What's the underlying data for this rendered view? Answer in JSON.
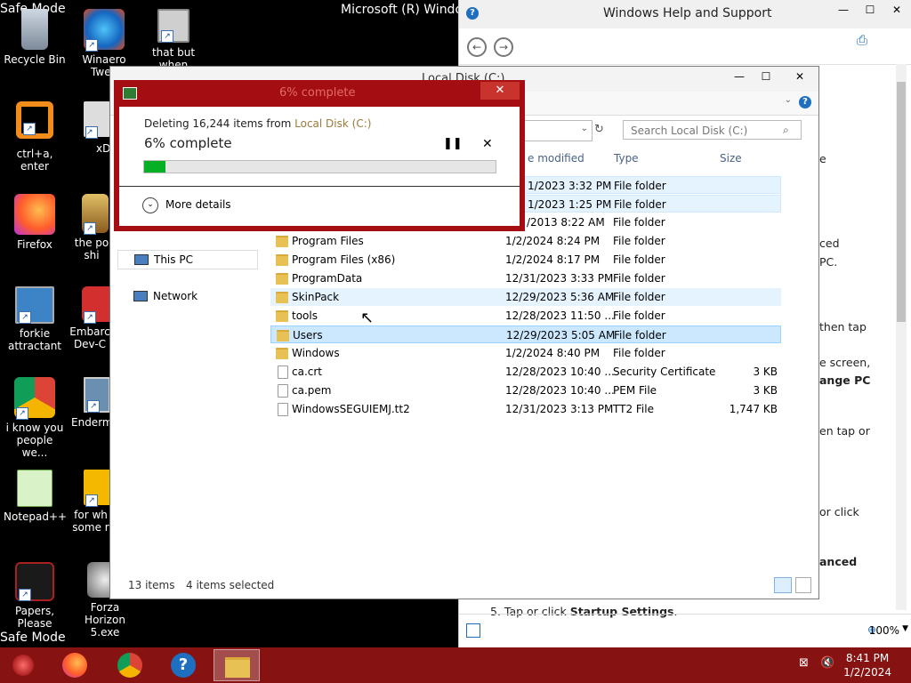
{
  "desktop": {
    "safe_mode_top": "Safe Mode",
    "safe_mode_bottom": "Safe Mode",
    "background_title": "Microsoft (R) Windo",
    "icons": [
      {
        "label": "Recycle Bin"
      },
      {
        "label": "Winaero Twea"
      },
      {
        "label": "that but when"
      },
      {
        "label": "ctrl+a, enter"
      },
      {
        "label": "xD"
      },
      {
        "label": "Firefox"
      },
      {
        "label": "the po shi"
      },
      {
        "label": "forkie attractant"
      },
      {
        "label": "Embarc Dev-C"
      },
      {
        "label": "i know you people we..."
      },
      {
        "label": "Enderm"
      },
      {
        "label": "Notepad++"
      },
      {
        "label": "for wh some r"
      },
      {
        "label": "Papers, Please"
      },
      {
        "label": "Forza Horizon 5.exe"
      }
    ]
  },
  "help": {
    "title": "Windows Help and Support",
    "fragments": [
      "ced",
      "PC.",
      "then tap",
      "e screen,",
      "ange PC",
      "en tap or",
      "or click",
      "anced",
      "e"
    ],
    "step": "5.  Tap or click ",
    "step_bold": "Startup Settings",
    "step_end": ".",
    "zoom": "100%"
  },
  "explorer": {
    "title": "Local Disk (C:)",
    "search_placeholder": "Search Local Disk (C:)",
    "columns": {
      "modified": "e modified",
      "type": "Type",
      "size": "Size"
    },
    "nav": {
      "this_pc": "This PC",
      "network": "Network"
    },
    "partial_rows": [
      {
        "date": "1/2023 3:32 PM",
        "type": "File folder"
      },
      {
        "date": "1/2023 1:25 PM",
        "type": "File folder"
      },
      {
        "date": "/2013 8:22 AM",
        "type": "File folder"
      }
    ],
    "rows": [
      {
        "name": "Program Files",
        "date": "1/2/2024 8:24 PM",
        "type": "File folder",
        "size": "",
        "kind": "folder"
      },
      {
        "name": "Program Files (x86)",
        "date": "1/2/2024 8:17 PM",
        "type": "File folder",
        "size": "",
        "kind": "folder"
      },
      {
        "name": "ProgramData",
        "date": "12/31/2023 3:33 PM",
        "type": "File folder",
        "size": "",
        "kind": "folder"
      },
      {
        "name": "SkinPack",
        "date": "12/29/2023 5:36 AM",
        "type": "File folder",
        "size": "",
        "kind": "folder"
      },
      {
        "name": "tools",
        "date": "12/28/2023 11:50 ...",
        "type": "File folder",
        "size": "",
        "kind": "folder"
      },
      {
        "name": "Users",
        "date": "12/29/2023 5:05 AM",
        "type": "File folder",
        "size": "",
        "kind": "folder"
      },
      {
        "name": "Windows",
        "date": "1/2/2024 8:40 PM",
        "type": "File folder",
        "size": "",
        "kind": "folder"
      },
      {
        "name": "ca.crt",
        "date": "12/28/2023 10:40 ...",
        "type": "Security Certificate",
        "size": "3 KB",
        "kind": "doc"
      },
      {
        "name": "ca.pem",
        "date": "12/28/2023 10:40 ...",
        "type": "PEM File",
        "size": "3 KB",
        "kind": "doc"
      },
      {
        "name": "WindowsSEGUIEMJ.tt2",
        "date": "12/31/2023 3:13 PM",
        "type": "TT2 File",
        "size": "1,747 KB",
        "kind": "doc"
      }
    ],
    "status_items": "13 items",
    "status_selected": "4 items selected"
  },
  "dialog": {
    "title": "6% complete",
    "deleting_prefix": "Deleting 16,244 items from ",
    "deleting_source": "Local Disk (C:)",
    "percent_text": "6% complete",
    "progress": 0.06,
    "more_details": "More details"
  },
  "taskbar": {
    "time": "8:41 PM",
    "date": "1/2/2024"
  },
  "colors": {
    "dialog_frame": "#a40e12",
    "taskbar": "#861212",
    "progress": "#06b025",
    "selection": "#cce8ff"
  }
}
